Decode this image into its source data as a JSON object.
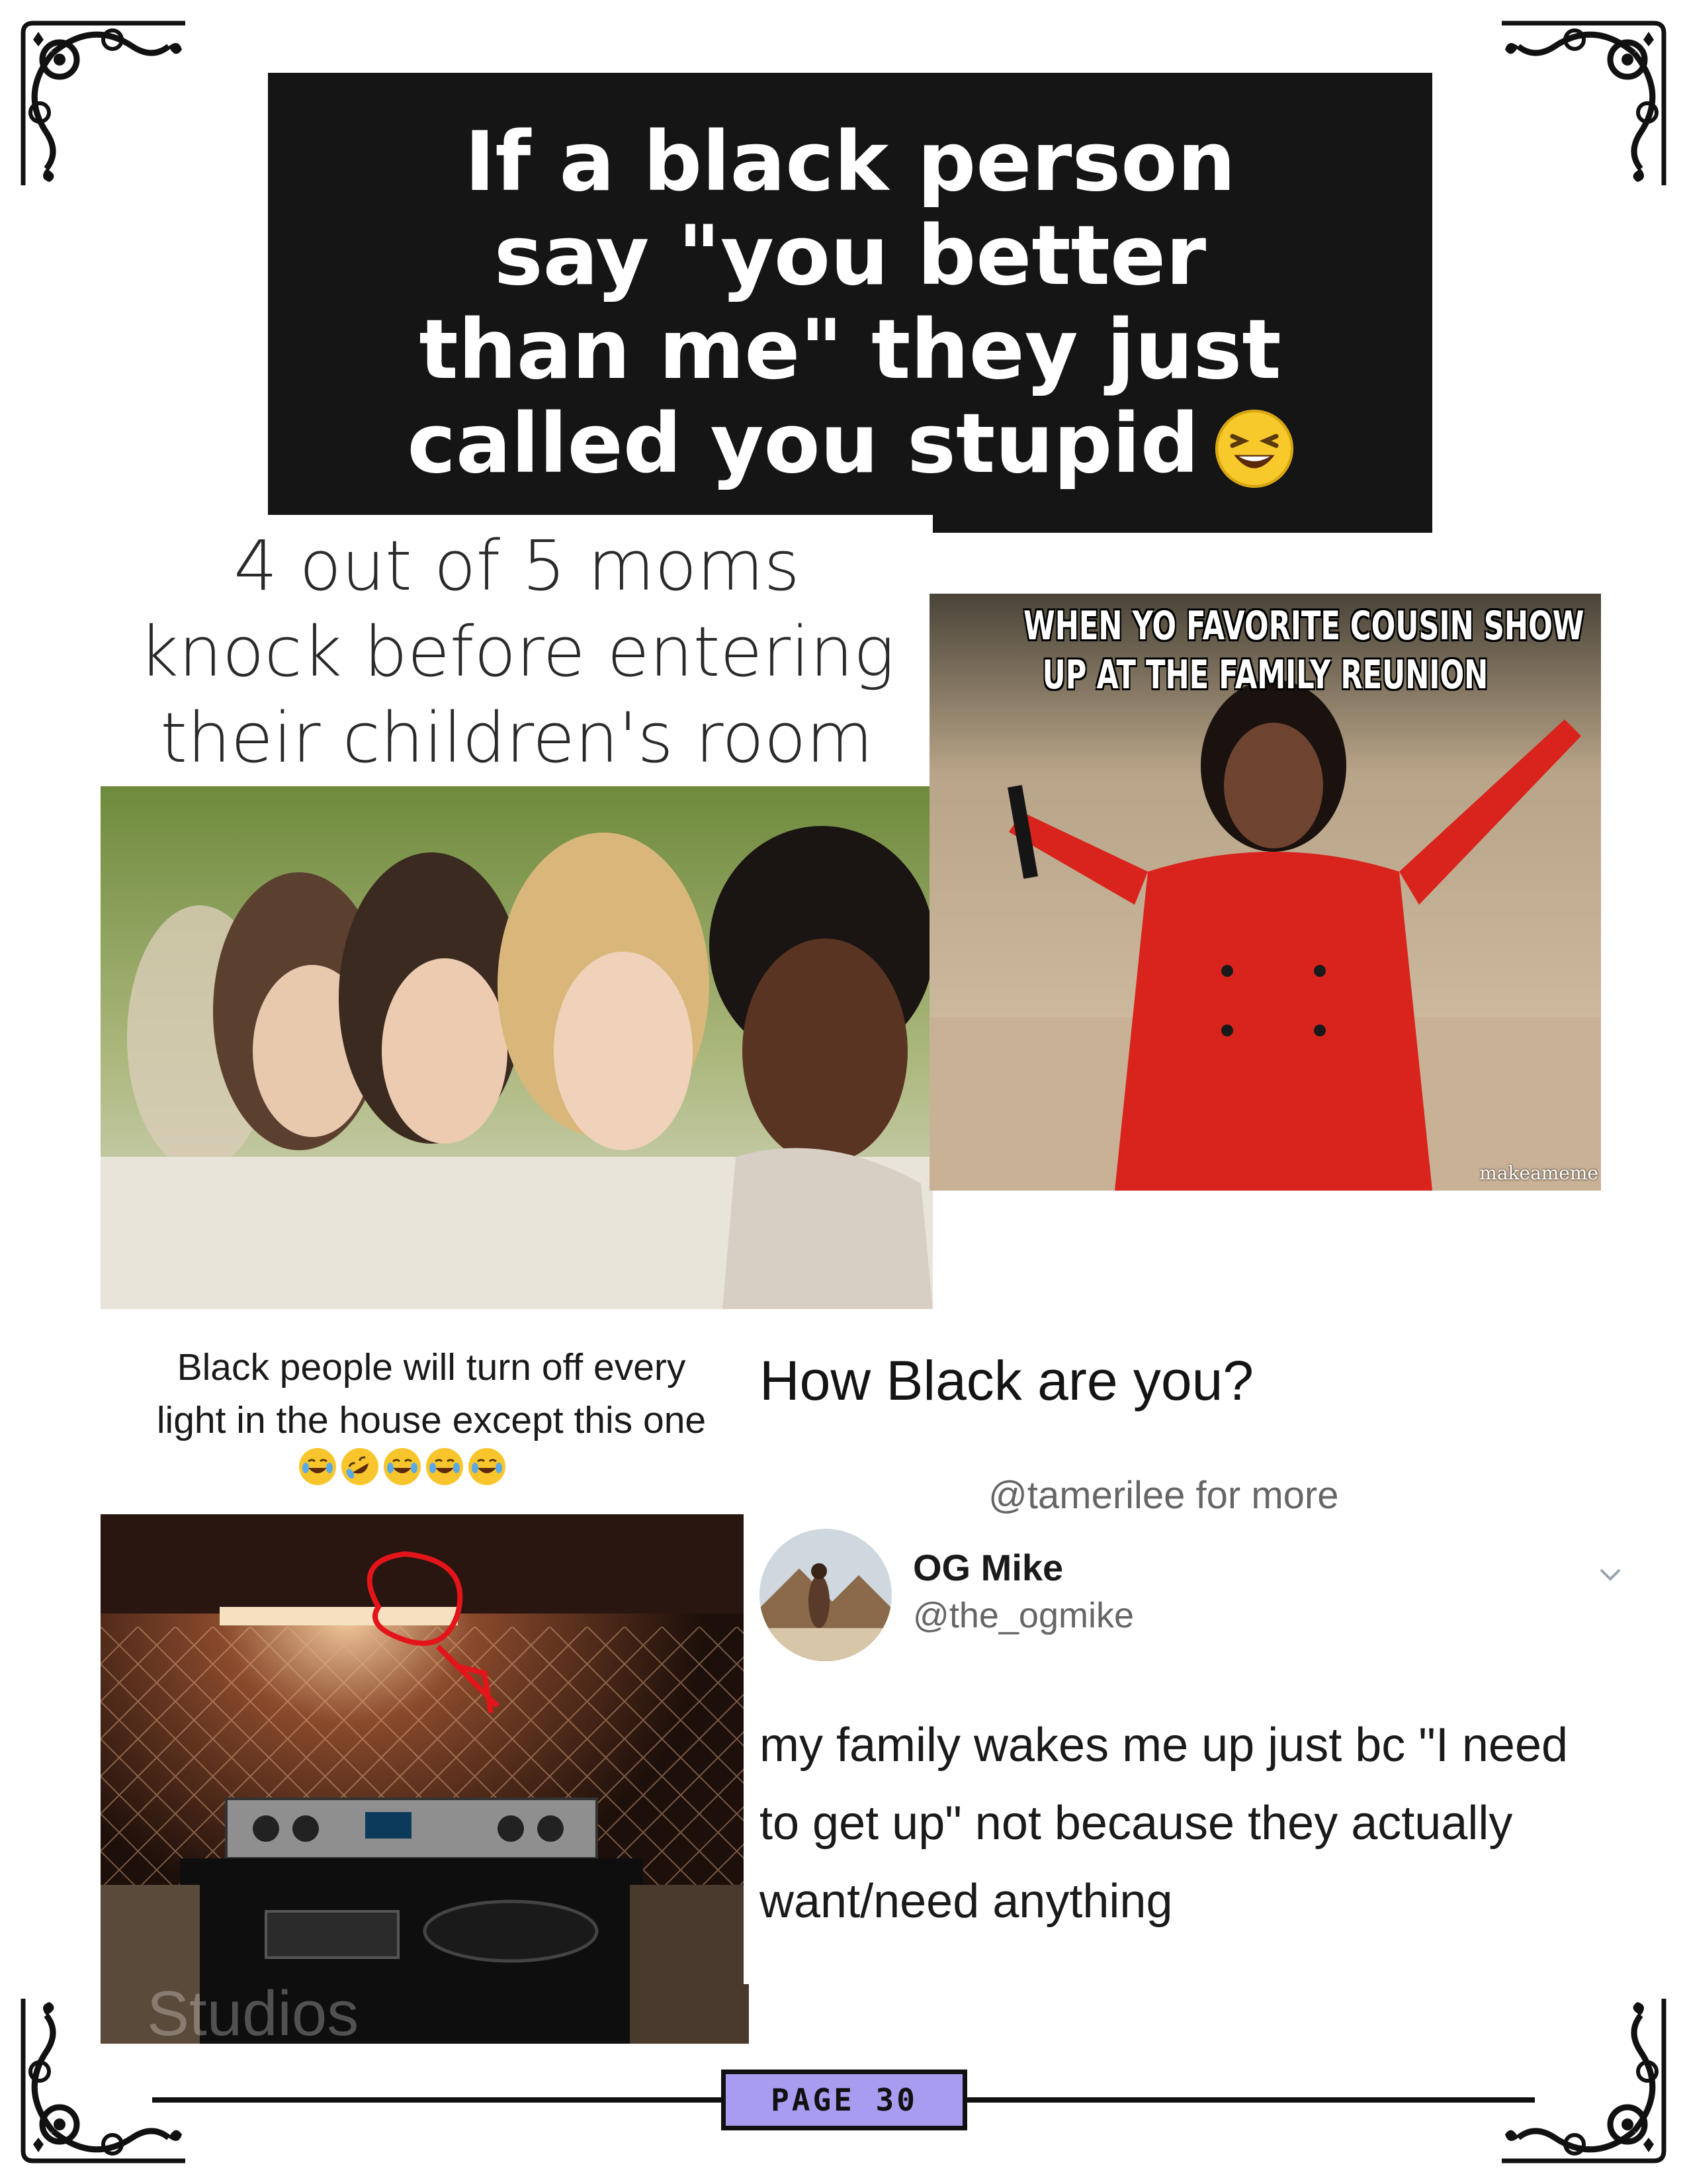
{
  "headline": {
    "lines": [
      "If a black person",
      "say \"you better",
      "than me\" they just",
      "called you stupid"
    ],
    "emoji": "laughing-squinting-face"
  },
  "moms_meme": {
    "caption_lines": [
      "4 out of 5 moms",
      "knock before entering",
      "their children's room"
    ]
  },
  "cousin_meme": {
    "caption_lines": [
      "WHEN YO FAVORITE COUSIN SHOW",
      "UP AT THE FAMILY REUNION"
    ],
    "watermark": "makeameme"
  },
  "lights_meme": {
    "caption_lines": [
      "Black people will turn off every",
      "light in the house except this one"
    ],
    "emojis": [
      "face-with-tears-of-joy",
      "rolling-on-floor-laughing",
      "face-with-tears-of-joy",
      "face-with-tears-of-joy",
      "face-with-tears-of-joy"
    ],
    "photo_watermark": "Studios"
  },
  "tweet_meme": {
    "title": "How Black are you?",
    "credit": "@tamerilee for more",
    "author_name": "OG Mike",
    "author_handle": "@the_ogmike",
    "body_lines": [
      "my family wakes me up just bc \"I need",
      "to get up\" not because they actually",
      "want/need anything"
    ]
  },
  "footer": {
    "page_label": "PAGE 30",
    "badge_color": "#a89cf0"
  }
}
